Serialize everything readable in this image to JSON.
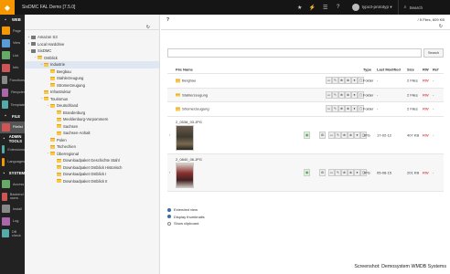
{
  "app": {
    "title": "SixDMC FAL Demo [7.5.0]"
  },
  "topbar": {
    "icons": [
      "star-icon",
      "bolt-icon",
      "list-icon",
      "help-icon"
    ],
    "user": "typo3-prototyp ▾",
    "search_label": "Search"
  },
  "modmenu": {
    "groups": [
      {
        "label": "WEB",
        "items": [
          "Page",
          "View",
          "List",
          "Info",
          "Functions",
          "Recycler",
          "Template"
        ]
      },
      {
        "label": "FILE",
        "items": [
          "Filelist"
        ]
      },
      {
        "label": "ADMIN TOOLS",
        "items": [
          "Extensions",
          "Languages"
        ]
      },
      {
        "label": "SYSTEM",
        "items": [
          "Access",
          "Backend users",
          "Install",
          "Log",
          "DB check"
        ]
      }
    ],
    "active": "Filelist"
  },
  "tree": {
    "nodes": [
      {
        "label": "Amazon S3",
        "depth": 0,
        "kind": "storage"
      },
      {
        "label": "Local Harddrive",
        "depth": 0,
        "kind": "storage"
      },
      {
        "label": "SixDMC",
        "depth": 0,
        "kind": "storage"
      },
      {
        "label": "Ostblick",
        "depth": 1,
        "kind": "folder"
      },
      {
        "label": "Industrie",
        "depth": 2,
        "kind": "folder",
        "selected": true
      },
      {
        "label": "Bergbau",
        "depth": 3,
        "kind": "folder"
      },
      {
        "label": "Stahlerzeugung",
        "depth": 3,
        "kind": "folder"
      },
      {
        "label": "Stromerzeugung",
        "depth": 3,
        "kind": "folder"
      },
      {
        "label": "Infrastruktur",
        "depth": 2,
        "kind": "folder"
      },
      {
        "label": "Tourismus",
        "depth": 2,
        "kind": "folder"
      },
      {
        "label": "Deutschland",
        "depth": 3,
        "kind": "folder"
      },
      {
        "label": "Brandenburg",
        "depth": 4,
        "kind": "folder"
      },
      {
        "label": "Mecklenburg-Vorpommern",
        "depth": 4,
        "kind": "folder"
      },
      {
        "label": "Sachsen",
        "depth": 4,
        "kind": "folder"
      },
      {
        "label": "Sachsen-Anhalt",
        "depth": 4,
        "kind": "folder"
      },
      {
        "label": "Polen",
        "depth": 3,
        "kind": "folder"
      },
      {
        "label": "Tschechien",
        "depth": 3,
        "kind": "folder"
      },
      {
        "label": "Überregional",
        "depth": 3,
        "kind": "folder"
      },
      {
        "label": "Downloadpaket Geschichte Stahl",
        "depth": 4,
        "kind": "folder"
      },
      {
        "label": "Downloadpaket Ostblick Historisch",
        "depth": 4,
        "kind": "folder"
      },
      {
        "label": "Downloadpaket Ostblick I",
        "depth": 4,
        "kind": "folder"
      },
      {
        "label": "Downloadpaket Ostblick II",
        "depth": 4,
        "kind": "folder"
      }
    ]
  },
  "main": {
    "file_count": "/ 5 Files, 609 KB",
    "search_button": "Search",
    "columns": {
      "name": "File Name",
      "type": "Type",
      "modified": "Last Modified",
      "size": "Size",
      "rw": "RW",
      "ref": "Ref"
    },
    "folders": [
      {
        "name": "Bergbau",
        "type": "Folder",
        "modified": "-",
        "size": "2 Files",
        "rw": "RW",
        "ref": "-"
      },
      {
        "name": "Stahlerzeugung",
        "type": "Folder",
        "modified": "-",
        "size": "2 Files",
        "rw": "RW",
        "ref": "-"
      },
      {
        "name": "Stromerzeugung",
        "type": "Folder",
        "modified": "-",
        "size": "2 Files",
        "rw": "RW",
        "ref": "-"
      }
    ],
    "files": [
      {
        "name": "2_0538_03.JPG",
        "type": "JPG",
        "modified": "17-02-12",
        "size": "407 KB",
        "rw": "RW",
        "ref": "-"
      },
      {
        "name": "2_0840_06.JPG",
        "type": "JPG",
        "modified": "05-08-15",
        "size": "201 KB",
        "rw": "RW",
        "ref": "-"
      }
    ],
    "options": [
      {
        "label": "Extended view",
        "checked": true
      },
      {
        "label": "Display thumbnails",
        "checked": true
      },
      {
        "label": "Show clipboard",
        "checked": false
      }
    ]
  },
  "caption": "Screenshot: Demosystem WMDB Systems",
  "colors": {
    "topbar": "#151515",
    "brand": "#f49700",
    "modmenu": "#222222",
    "accent": "#3a6ea5",
    "rw": "#cc0000"
  }
}
